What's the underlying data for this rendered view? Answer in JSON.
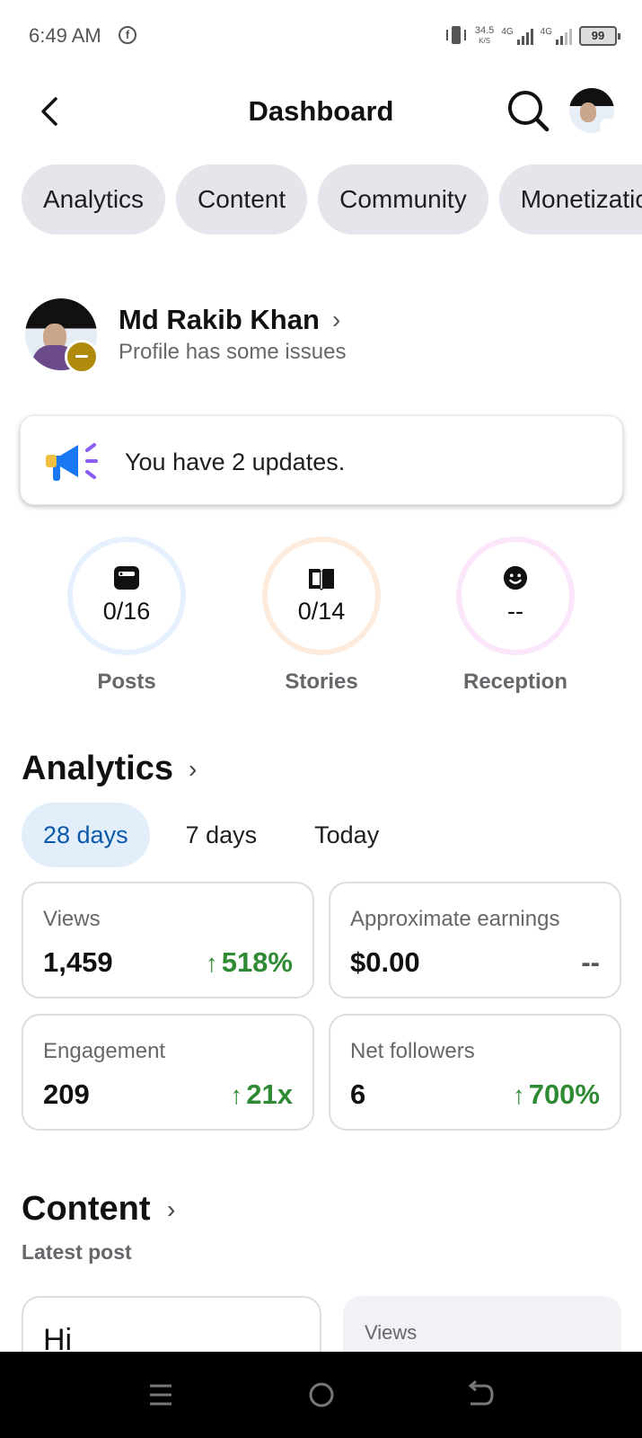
{
  "status_bar": {
    "time": "6:49 AM",
    "network_speed": "34.5",
    "network_speed_unit": "K/S",
    "signal1_label": "4G",
    "signal2_label": "4G",
    "battery": "99"
  },
  "header": {
    "title": "Dashboard"
  },
  "tabs": [
    {
      "label": "Analytics"
    },
    {
      "label": "Content"
    },
    {
      "label": "Community"
    },
    {
      "label": "Monetization"
    }
  ],
  "profile": {
    "name": "Md Rakib Khan",
    "status": "Profile has some issues"
  },
  "updates": {
    "text": "You have 2 updates."
  },
  "goals": [
    {
      "label": "Posts",
      "value": "0/16",
      "icon": "post-icon",
      "color": "#e6f0ff"
    },
    {
      "label": "Stories",
      "value": "0/14",
      "icon": "book-icon",
      "color": "#fdebdd"
    },
    {
      "label": "Reception",
      "value": "--",
      "icon": "smiley-icon",
      "color": "#fbe6fb"
    }
  ],
  "analytics": {
    "title": "Analytics",
    "periods": [
      {
        "label": "28 days",
        "active": true
      },
      {
        "label": "7 days",
        "active": false
      },
      {
        "label": "Today",
        "active": false
      }
    ],
    "metrics": [
      {
        "label": "Views",
        "value": "1,459",
        "change": "518%",
        "trend": "up"
      },
      {
        "label": "Approximate earnings",
        "value": "$0.00",
        "change": "--",
        "trend": "none"
      },
      {
        "label": "Engagement",
        "value": "209",
        "change": "21x",
        "trend": "up"
      },
      {
        "label": "Net followers",
        "value": "6",
        "change": "700%",
        "trend": "up"
      }
    ]
  },
  "content": {
    "title": "Content",
    "subtitle": "Latest post",
    "latest_post_text": "Hi",
    "views_label": "Views"
  },
  "colors": {
    "positive": "#2e8b34",
    "accent": "#0a58a8",
    "pill_bg": "#e4e6eb"
  }
}
